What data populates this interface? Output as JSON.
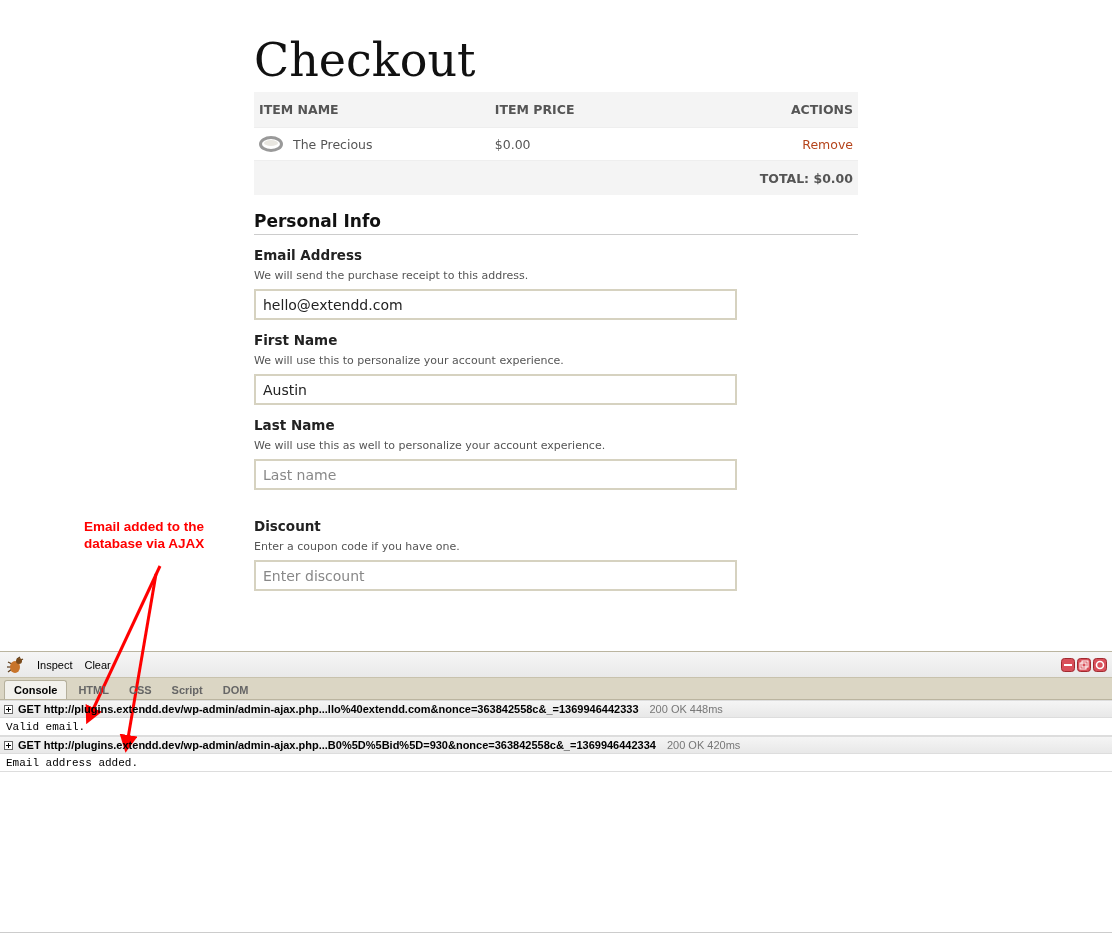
{
  "page": {
    "title": "Checkout"
  },
  "cart": {
    "columns": [
      "ITEM NAME",
      "ITEM PRICE",
      "ACTIONS"
    ],
    "items": [
      {
        "name": "The Precious",
        "price": "$0.00",
        "action": "Remove"
      }
    ],
    "total": "TOTAL: $0.00"
  },
  "personal_info": {
    "heading": "Personal Info",
    "fields": [
      {
        "label": "Email Address",
        "hint": "We will send the purchase receipt to this address.",
        "value": "hello@extendd.com"
      },
      {
        "label": "First Name",
        "hint": "We will use this to personalize your account experience.",
        "value": "Austin"
      },
      {
        "label": "Last Name",
        "hint": "We will use this as well to personalize your account experience.",
        "placeholder": "Last name"
      }
    ]
  },
  "discount": {
    "label": "Discount",
    "hint": "Enter a coupon code if you have one.",
    "placeholder": "Enter discount"
  },
  "annotation": {
    "text": "Email added to the\ndatabase via AJAX"
  },
  "devtools": {
    "toolbar": [
      "Inspect",
      "Clear"
    ],
    "tabs": [
      {
        "label": "Console",
        "selected": true
      },
      {
        "label": "HTML",
        "selected": false
      },
      {
        "label": "CSS",
        "selected": false
      },
      {
        "label": "Script",
        "selected": false
      },
      {
        "label": "DOM",
        "selected": false
      }
    ],
    "log": [
      {
        "kind": "request",
        "text": "GET http://plugins.extendd.dev/wp-admin/admin-ajax.php...llo%40extendd.com&nonce=363842558c&_=1369946442333",
        "status": "200 OK 448ms"
      },
      {
        "kind": "response",
        "text": "Valid email."
      },
      {
        "kind": "request",
        "text": "GET http://plugins.extendd.dev/wp-admin/admin-ajax.php...B0%5D%5Bid%5D=930&nonce=363842558c&_=1369946442334",
        "status": "200 OK 420ms"
      },
      {
        "kind": "response",
        "text": "Email address added."
      }
    ]
  }
}
